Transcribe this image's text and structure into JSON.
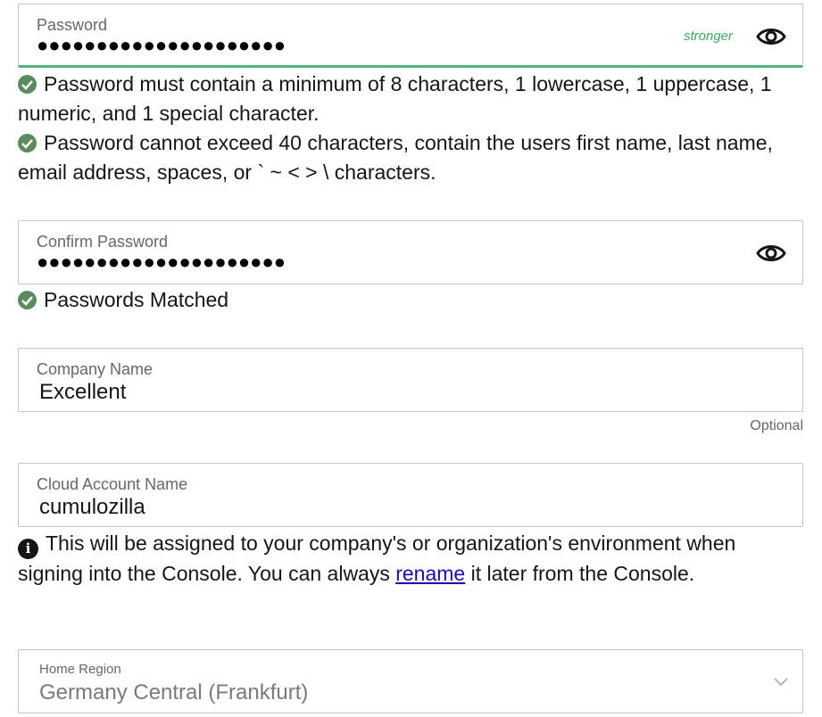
{
  "password": {
    "label": "Password",
    "value": "●●●●●●●●●●●●●●●●●●●●●",
    "strength": "stronger",
    "eye_icon": "eye-icon"
  },
  "password_rules": [
    "Password must contain a minimum of 8 characters, 1 lowercase, 1 uppercase, 1 numeric, and 1 special character.",
    "Password cannot exceed 40 characters, contain the users first name, last name, email address, spaces, or ` ~ < > \\ characters."
  ],
  "confirm_password": {
    "label": "Confirm Password",
    "value": "●●●●●●●●●●●●●●●●●●●●●",
    "eye_icon": "eye-icon"
  },
  "confirm_status": "Passwords Matched",
  "company": {
    "label": "Company Name",
    "value": "Excellent",
    "hint": "Optional"
  },
  "cloud_account": {
    "label": "Cloud Account Name",
    "value": "cumulozilla",
    "info_before": "This will be assigned to your company's or organization's environment when signing into the Console. You can always ",
    "info_link": "rename",
    "info_after": " it later from the Console."
  },
  "home_region": {
    "label": "Home Region",
    "value": "Germany Central (Frankfurt)"
  },
  "colors": {
    "success": "#57b37c",
    "check_bg": "#5a8a5e",
    "link": "#1a0dab"
  }
}
